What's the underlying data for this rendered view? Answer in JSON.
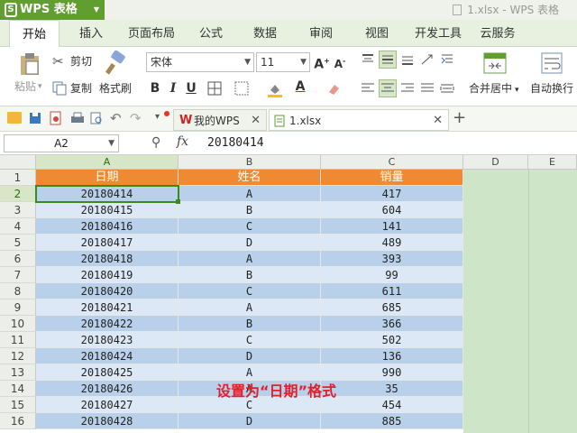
{
  "app": {
    "name": "WPS 表格",
    "window_title": "1.xlsx - WPS 表格"
  },
  "ribbon_tabs": [
    "开始",
    "插入",
    "页面布局",
    "公式",
    "数据",
    "审阅",
    "视图",
    "开发工具",
    "云服务"
  ],
  "ribbon": {
    "paste": "粘贴",
    "cut": "剪切",
    "copy": "复制",
    "format_painter": "格式刷",
    "font_name": "宋体",
    "font_size": "11",
    "merge_center": "合并居中",
    "wrap_text": "自动换行"
  },
  "doc_tabs": [
    {
      "label": "我的WPS"
    },
    {
      "label": "1.xlsx"
    }
  ],
  "formula_bar": {
    "name_box": "A2",
    "fx": "fx",
    "value": "20180414"
  },
  "columns": [
    "A",
    "B",
    "C",
    "D",
    "E"
  ],
  "headers": [
    "日期",
    "姓名",
    "销量"
  ],
  "rows": [
    [
      "20180414",
      "A",
      "417"
    ],
    [
      "20180415",
      "B",
      "604"
    ],
    [
      "20180416",
      "C",
      "141"
    ],
    [
      "20180417",
      "D",
      "489"
    ],
    [
      "20180418",
      "A",
      "393"
    ],
    [
      "20180419",
      "B",
      "99"
    ],
    [
      "20180420",
      "C",
      "611"
    ],
    [
      "20180421",
      "A",
      "685"
    ],
    [
      "20180422",
      "B",
      "366"
    ],
    [
      "20180423",
      "C",
      "502"
    ],
    [
      "20180424",
      "D",
      "136"
    ],
    [
      "20180425",
      "A",
      "990"
    ],
    [
      "20180426",
      "A",
      "35"
    ],
    [
      "20180427",
      "C",
      "454"
    ],
    [
      "20180428",
      "D",
      "885"
    ]
  ],
  "row_numbers": [
    "1",
    "2",
    "3",
    "4",
    "5",
    "6",
    "7",
    "8",
    "9",
    "10",
    "11",
    "12",
    "13",
    "14",
    "15",
    "16"
  ],
  "caption": "设置为“日期”格式",
  "colors": {
    "accent": "#5f9e2f",
    "header_fill": "#ef8a32",
    "band_light": "#dce8f5",
    "band_dark": "#b9d0ea",
    "caption": "#e1202a"
  }
}
